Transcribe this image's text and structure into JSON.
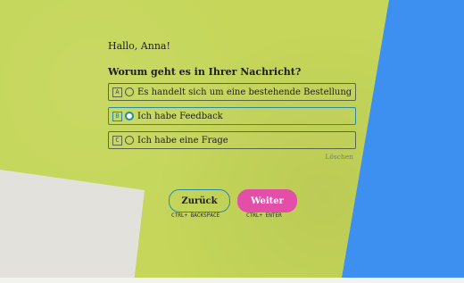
{
  "form": {
    "greeting": "Hallo, Anna!",
    "question": "Worum geht es in Ihrer Nachricht?",
    "options": [
      {
        "key": "A",
        "label": "Es handelt sich um eine bestehende Bestellung",
        "selected": false
      },
      {
        "key": "B",
        "label": "Ich habe Feedback",
        "selected": true
      },
      {
        "key": "C",
        "label": "Ich habe eine Frage",
        "selected": false
      }
    ],
    "clear_label": "Löschen"
  },
  "navigation": {
    "back_label": "Zurück",
    "back_shortcut": "CTRL+ BACKSPACE",
    "next_label": "Weiter",
    "next_shortcut": "CTRL+ ENTER"
  },
  "colors": {
    "background_lime": "#c5d65a",
    "background_blue": "#3d8ff0",
    "background_grey": "#e3e1dc",
    "accent_teal": "#2b8aa3",
    "accent_pink": "#e34fa8"
  }
}
